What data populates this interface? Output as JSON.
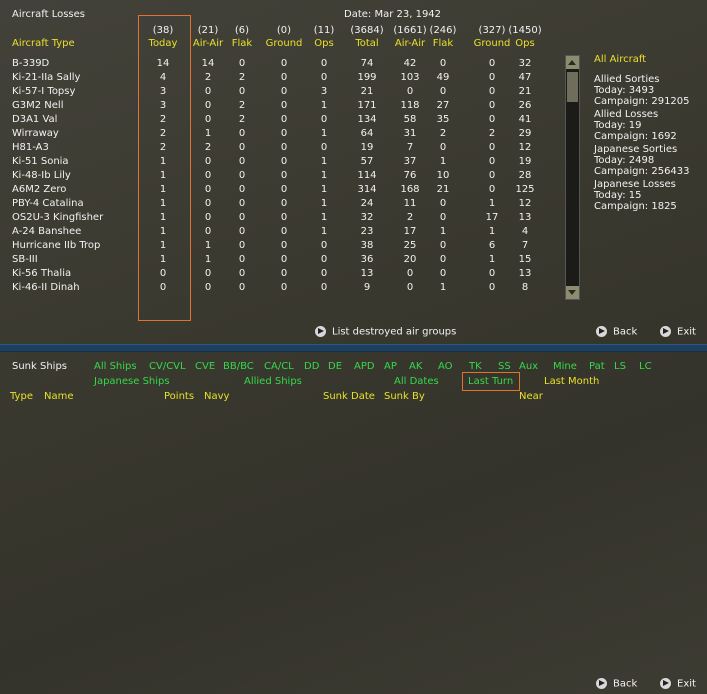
{
  "window": {
    "title": "Aircraft Losses",
    "date": "Date: Mar 23, 1942"
  },
  "table": {
    "headers": [
      {
        "total": "",
        "label": "Aircraft Type"
      },
      {
        "total": "(38)",
        "label": "Today"
      },
      {
        "total": "(21)",
        "label": "Air-Air"
      },
      {
        "total": "(6)",
        "label": "Flak"
      },
      {
        "total": "(0)",
        "label": "Ground"
      },
      {
        "total": "(11)",
        "label": "Ops"
      },
      {
        "total": "(3684)",
        "label": "Total"
      },
      {
        "total": "(1661)",
        "label": "Air-Air"
      },
      {
        "total": "(246)",
        "label": "Flak"
      },
      {
        "total": "(327)",
        "label": "Ground"
      },
      {
        "total": "(1450)",
        "label": "Ops"
      }
    ],
    "rows": [
      [
        "B-339D",
        "14",
        "14",
        "0",
        "0",
        "0",
        "74",
        "42",
        "0",
        "0",
        "32"
      ],
      [
        "Ki-21-IIa Sally",
        "4",
        "2",
        "2",
        "0",
        "0",
        "199",
        "103",
        "49",
        "0",
        "47"
      ],
      [
        "Ki-57-I Topsy",
        "3",
        "0",
        "0",
        "0",
        "3",
        "21",
        "0",
        "0",
        "0",
        "21"
      ],
      [
        "G3M2 Nell",
        "3",
        "0",
        "2",
        "0",
        "1",
        "171",
        "118",
        "27",
        "0",
        "26"
      ],
      [
        "D3A1 Val",
        "2",
        "0",
        "2",
        "0",
        "0",
        "134",
        "58",
        "35",
        "0",
        "41"
      ],
      [
        "Wirraway",
        "2",
        "1",
        "0",
        "0",
        "1",
        "64",
        "31",
        "2",
        "2",
        "29"
      ],
      [
        "H81-A3",
        "2",
        "2",
        "0",
        "0",
        "0",
        "19",
        "7",
        "0",
        "0",
        "12"
      ],
      [
        "Ki-51 Sonia",
        "1",
        "0",
        "0",
        "0",
        "1",
        "57",
        "37",
        "1",
        "0",
        "19"
      ],
      [
        "Ki-48-Ib Lily",
        "1",
        "0",
        "0",
        "0",
        "1",
        "114",
        "76",
        "10",
        "0",
        "28"
      ],
      [
        "A6M2 Zero",
        "1",
        "0",
        "0",
        "0",
        "1",
        "314",
        "168",
        "21",
        "0",
        "125"
      ],
      [
        "PBY-4 Catalina",
        "1",
        "0",
        "0",
        "0",
        "1",
        "24",
        "11",
        "0",
        "1",
        "12"
      ],
      [
        "OS2U-3 Kingfisher",
        "1",
        "0",
        "0",
        "0",
        "1",
        "32",
        "2",
        "0",
        "17",
        "13"
      ],
      [
        "A-24 Banshee",
        "1",
        "0",
        "0",
        "0",
        "1",
        "23",
        "17",
        "1",
        "1",
        "4"
      ],
      [
        "Hurricane IIb Trop",
        "1",
        "1",
        "0",
        "0",
        "0",
        "38",
        "25",
        "0",
        "6",
        "7"
      ],
      [
        "SB-III",
        "1",
        "1",
        "0",
        "0",
        "0",
        "36",
        "20",
        "0",
        "1",
        "15"
      ],
      [
        "Ki-56 Thalia",
        "0",
        "0",
        "0",
        "0",
        "0",
        "13",
        "0",
        "0",
        "0",
        "13"
      ],
      [
        "Ki-46-II Dinah",
        "0",
        "0",
        "0",
        "0",
        "0",
        "9",
        "0",
        "1",
        "0",
        "8"
      ]
    ]
  },
  "summary": {
    "all_aircraft": "All Aircraft",
    "allied_sorties": {
      "title": "Allied Sorties",
      "today": "Today:   3493",
      "campaign": "Campaign: 291205"
    },
    "allied_losses": {
      "title": "Allied Losses",
      "today": "Today:   19",
      "campaign": "Campaign: 1692"
    },
    "japanese_sorties": {
      "title": "Japanese Sorties",
      "today": "Today:   2498",
      "campaign": "Campaign: 256433"
    },
    "japanese_losses": {
      "title": "Japanese Losses",
      "today": "Today:   15",
      "campaign": "Campaign: 1825"
    }
  },
  "top_buttons": {
    "list_destroyed": "List destroyed air groups",
    "back": "Back",
    "exit": "Exit"
  },
  "sunk": {
    "title": "Sunk Ships",
    "filters": [
      "All Ships",
      "CV/CVL",
      "CVE",
      "BB/BC",
      "CA/CL",
      "DD",
      "DE",
      "APD",
      "AP",
      "AK",
      "AO",
      "TK",
      "SS",
      "Aux",
      "Mine",
      "Pat",
      "LS",
      "LC"
    ],
    "japanese": "Japanese Ships",
    "allied": "Allied Ships",
    "dates": {
      "all": "All Dates",
      "last_turn": "Last Turn",
      "last_month": "Last Month"
    },
    "columns": {
      "type": "Type",
      "name": "Name",
      "points": "Points",
      "navy": "Navy",
      "sunk_date": "Sunk Date",
      "sunk_by": "Sunk By",
      "near": "Near"
    }
  },
  "bottom_buttons": {
    "back": "Back",
    "exit": "Exit"
  },
  "colors": {
    "header": "#e8e02a",
    "filter": "#36d84a",
    "highlight": "#e0742c",
    "divider": "#1f3f5f"
  }
}
